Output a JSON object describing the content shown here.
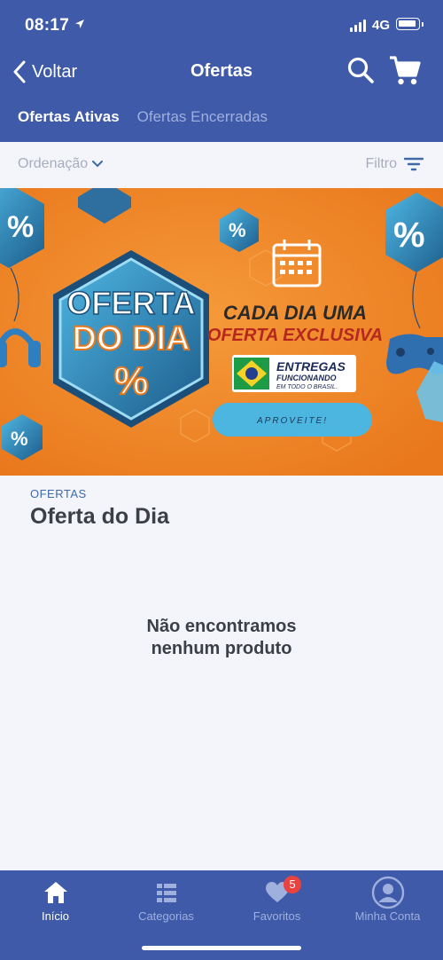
{
  "status_bar": {
    "time": "08:17",
    "network": "4G"
  },
  "header": {
    "back_label": "Voltar",
    "title": "Ofertas",
    "tabs": [
      {
        "label": "Ofertas Ativas",
        "active": true
      },
      {
        "label": "Ofertas Encerradas",
        "active": false
      }
    ]
  },
  "toolbar": {
    "sort_label": "Ordenação",
    "filter_label": "Filtro"
  },
  "banner": {
    "badge_line1": "OFERTA",
    "badge_line2": "DO DIA",
    "headline1": "CADA DIA UMA",
    "headline2": "OFERTA EXCLUSIVA",
    "delivery1": "ENTREGAS",
    "delivery2": "FUNCIONANDO",
    "delivery3": "EM TODO O BRASIL.",
    "cta": "APROVEITE!",
    "colors": {
      "background": "#f08a2c",
      "accent": "#4cb5e0"
    }
  },
  "section": {
    "label": "OFERTAS",
    "title": "Oferta do Dia"
  },
  "empty_state": {
    "line1": "Não encontramos",
    "line2": "nenhum produto"
  },
  "tab_bar": {
    "items": [
      {
        "label": "Início",
        "icon": "home-icon",
        "active": true
      },
      {
        "label": "Categorias",
        "icon": "grid-icon",
        "active": false
      },
      {
        "label": "Favoritos",
        "icon": "heart-icon",
        "active": false,
        "badge": "5"
      },
      {
        "label": "Minha Conta",
        "icon": "user-icon",
        "active": false
      }
    ]
  },
  "colors": {
    "primary": "#3e5aa8",
    "badge": "#e9423f"
  }
}
